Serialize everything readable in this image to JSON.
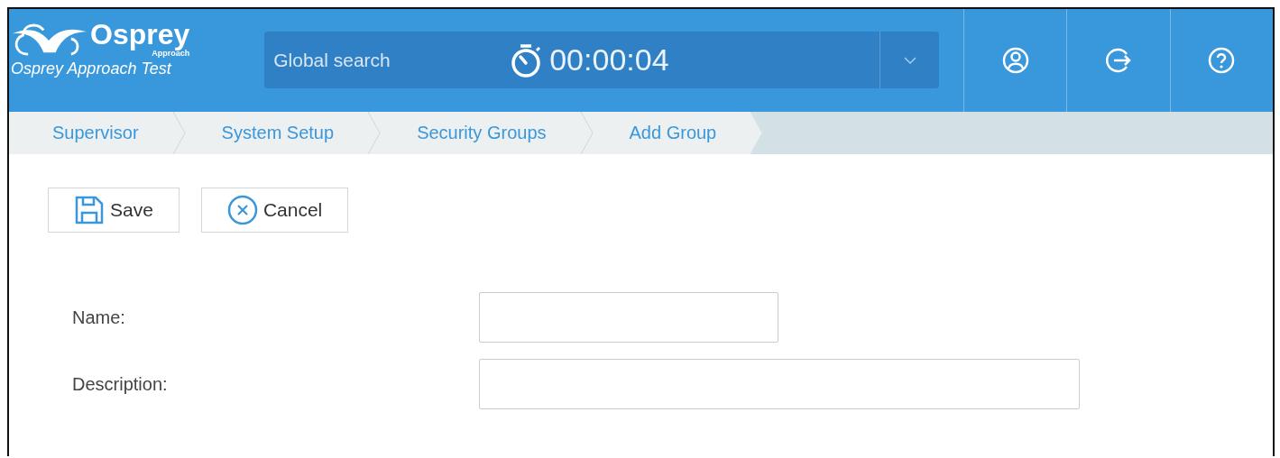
{
  "header": {
    "logo": "Osprey",
    "logo_sub": "Approach",
    "subtitle": "Osprey Approach Test",
    "search": {
      "placeholder": "Global search"
    },
    "timer": "00:00:04"
  },
  "breadcrumbs": [
    {
      "label": "Supervisor"
    },
    {
      "label": "System Setup"
    },
    {
      "label": "Security Groups"
    },
    {
      "label": "Add Group"
    }
  ],
  "toolbar": [
    {
      "kind": "save",
      "label": "Save"
    },
    {
      "kind": "cancel",
      "label": "Cancel"
    }
  ],
  "form": [
    {
      "label": "Name:"
    },
    {
      "label": "Description:"
    }
  ]
}
